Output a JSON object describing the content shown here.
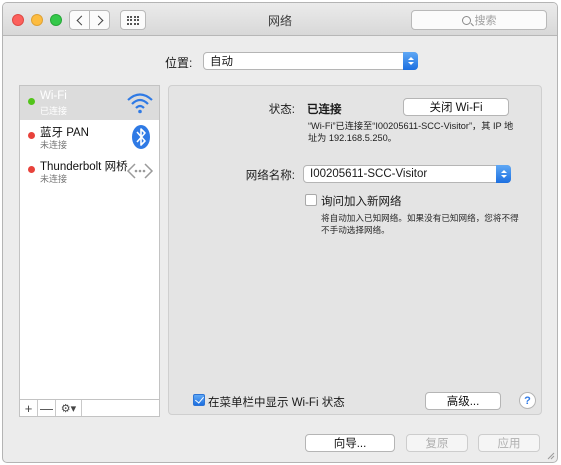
{
  "window": {
    "title": "网络"
  },
  "search": {
    "placeholder": "搜索"
  },
  "location": {
    "label": "位置:",
    "value": "自动"
  },
  "services": [
    {
      "name": "Wi-Fi",
      "status": "已连接",
      "dot": "green",
      "icon": "wifi-icon",
      "selected": true
    },
    {
      "name": "蓝牙 PAN",
      "status": "未连接",
      "dot": "red",
      "icon": "bluetooth-icon",
      "selected": false
    },
    {
      "name": "Thunderbolt 网桥",
      "status": "未连接",
      "dot": "red",
      "icon": "thunderbolt-bridge-icon",
      "selected": false
    }
  ],
  "sidebar_controls": {
    "add": "+",
    "remove": "—",
    "gear": "⚙▾"
  },
  "detail": {
    "status_label": "状态:",
    "status_value": "已连接",
    "turn_off_button": "关闭 Wi-Fi",
    "status_description": "“Wi-Fi”已连接至“I00205611-SCC-Visitor”，其 IP 地址为 192.168.5.250。",
    "network_name_label": "网络名称:",
    "network_name_value": "I00205611-SCC-Visitor",
    "ask_join_label": "询问加入新网络",
    "ask_join_checked": false,
    "ask_join_description": "将自动加入已知网络。如果没有已知网络，您将不得不手动选择网络。",
    "show_menubar_label": "在菜单栏中显示 Wi-Fi 状态",
    "show_menubar_checked": true,
    "advanced_button": "高级...",
    "help_button": "?"
  },
  "footer": {
    "assist_button": "向导...",
    "revert_button": "复原",
    "apply_button": "应用"
  },
  "colors": {
    "accent_blue": "#1c6fe0",
    "status_green": "#52c41a",
    "status_red": "#e8423b"
  }
}
